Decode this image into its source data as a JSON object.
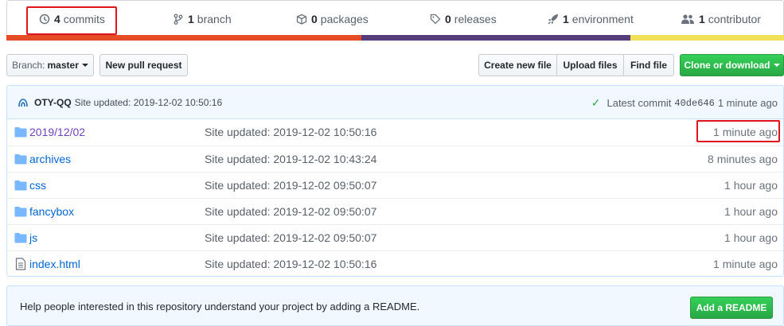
{
  "summary": {
    "commits": {
      "count": "4",
      "label": "commits",
      "icon": "history-icon"
    },
    "branches": {
      "count": "1",
      "label": "branch",
      "icon": "branch-icon"
    },
    "packages": {
      "count": "0",
      "label": "packages",
      "icon": "package-icon"
    },
    "releases": {
      "count": "0",
      "label": "releases",
      "icon": "tag-icon"
    },
    "environments": {
      "count": "1",
      "label": "environment",
      "icon": "rocket-icon"
    },
    "contributors": {
      "count": "1",
      "label": "contributor",
      "icon": "people-icon"
    }
  },
  "language_bar": {
    "colors": [
      "#e34c26",
      "#563d7c",
      "#f1e05a"
    ],
    "fractions": [
      0.457,
      0.345,
      0.198
    ]
  },
  "toolbar": {
    "branch_prefix": "Branch:",
    "branch_name": "master",
    "new_pull_request": "New pull request",
    "create_new_file": "Create new file",
    "upload_files": "Upload files",
    "find_file": "Find file",
    "clone_or_download": "Clone or download"
  },
  "commit_tease": {
    "author": "OTY-QQ",
    "message": "Site updated: 2019-12-02 10:50:16",
    "latest_label": "Latest commit",
    "sha": "40de646",
    "age": "1 minute ago"
  },
  "files": [
    {
      "type": "folder",
      "name": "2019/12/02",
      "message": "Site updated: 2019-12-02 10:50:16",
      "age": "1 minute ago"
    },
    {
      "type": "folder",
      "name": "archives",
      "message": "Site updated: 2019-12-02 10:43:24",
      "age": "8 minutes ago"
    },
    {
      "type": "folder",
      "name": "css",
      "message": "Site updated: 2019-12-02 09:50:07",
      "age": "1 hour ago"
    },
    {
      "type": "folder",
      "name": "fancybox",
      "message": "Site updated: 2019-12-02 09:50:07",
      "age": "1 hour ago"
    },
    {
      "type": "folder",
      "name": "js",
      "message": "Site updated: 2019-12-02 09:50:07",
      "age": "1 hour ago"
    },
    {
      "type": "file",
      "name": "index.html",
      "message": "Site updated: 2019-12-02 10:50:16",
      "age": "1 minute ago"
    }
  ],
  "readme": {
    "prompt": "Help people interested in this repository understand your project by adding a README.",
    "button": "Add a README"
  },
  "colors": {
    "link": "#0366d6",
    "green": "#28a745",
    "highlight": "#e0141e"
  }
}
